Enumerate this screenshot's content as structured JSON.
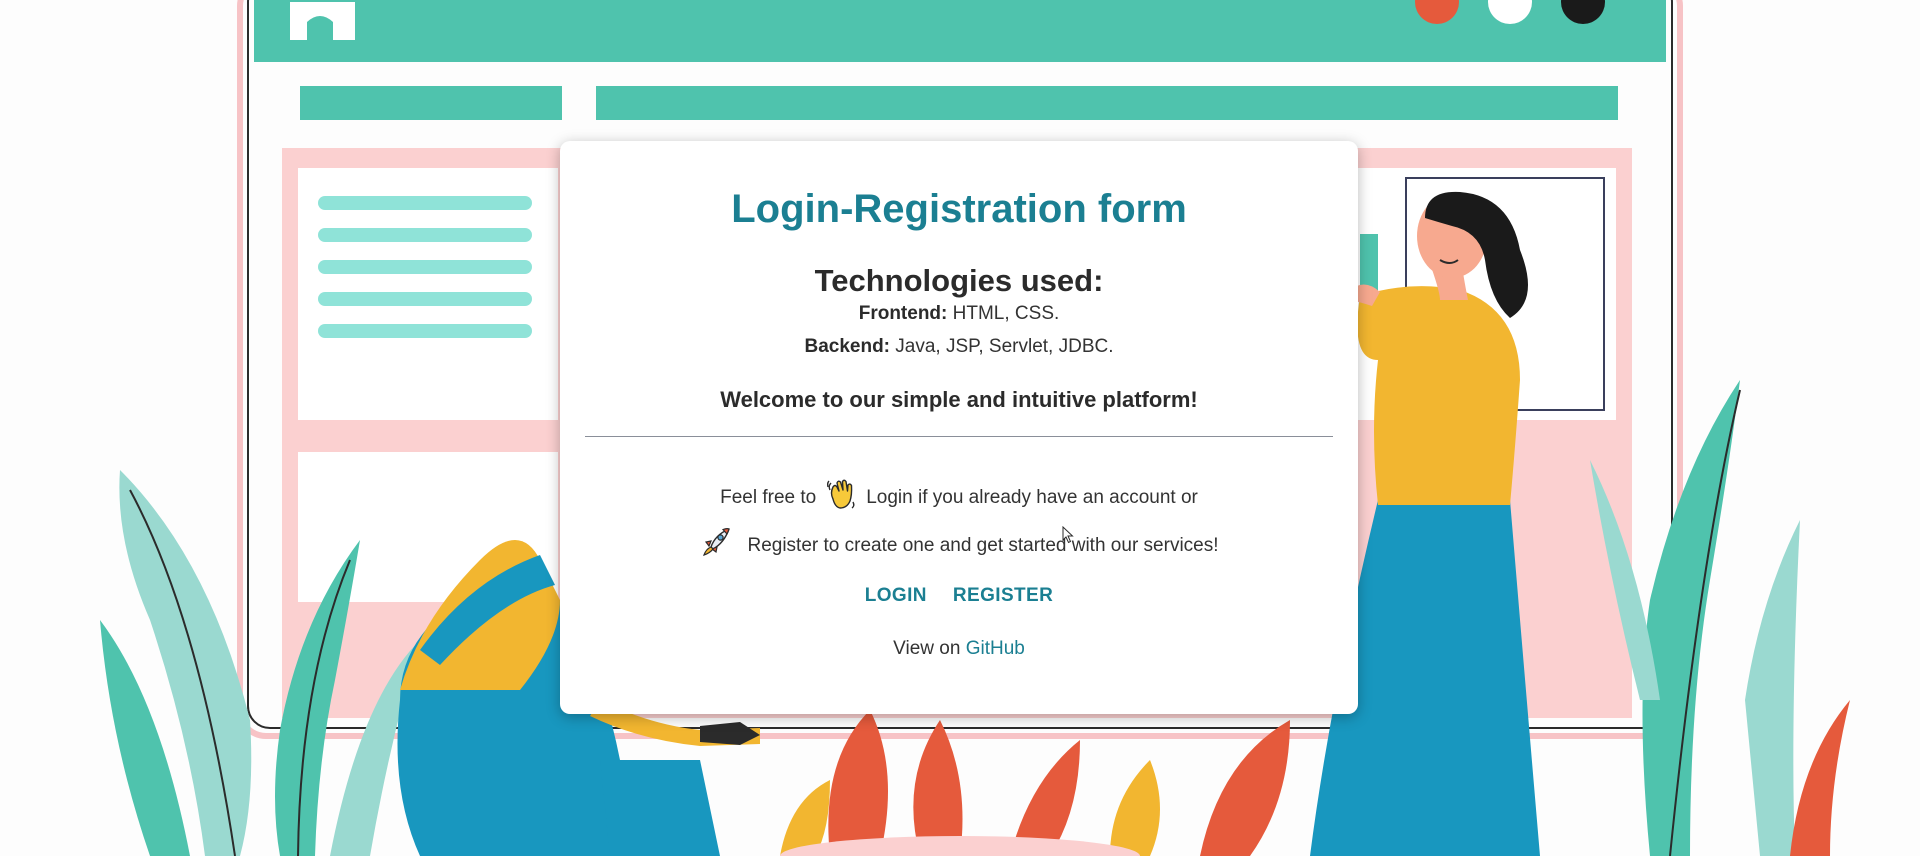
{
  "card": {
    "title": "Login-Registration form",
    "tech_heading": "Technologies used:",
    "frontend_label": "Frontend:",
    "frontend_value": " HTML, CSS.",
    "backend_label": "Backend:",
    "backend_value": " Java, JSP, Servlet, JDBC.",
    "welcome": "Welcome to our simple and intuitive platform!",
    "intro_prefix": "Feel free to",
    "intro_login": "Login if you already have an account or",
    "intro_register": "Register to create one and get started with our services!",
    "login_link": "LOGIN",
    "register_link": "REGISTER",
    "github_prefix": "View on ",
    "github_link": "GitHub"
  },
  "icons": {
    "wave": "waving-hand-icon",
    "rocket": "rocket-icon"
  },
  "colors": {
    "accent": "#1b7f92",
    "teal": "#4fc3ad",
    "pink": "#fbd0d0",
    "yellow": "#f2b630",
    "blue": "#1897bf",
    "coral": "#e55a3c",
    "mint": "#8fd8cf"
  }
}
